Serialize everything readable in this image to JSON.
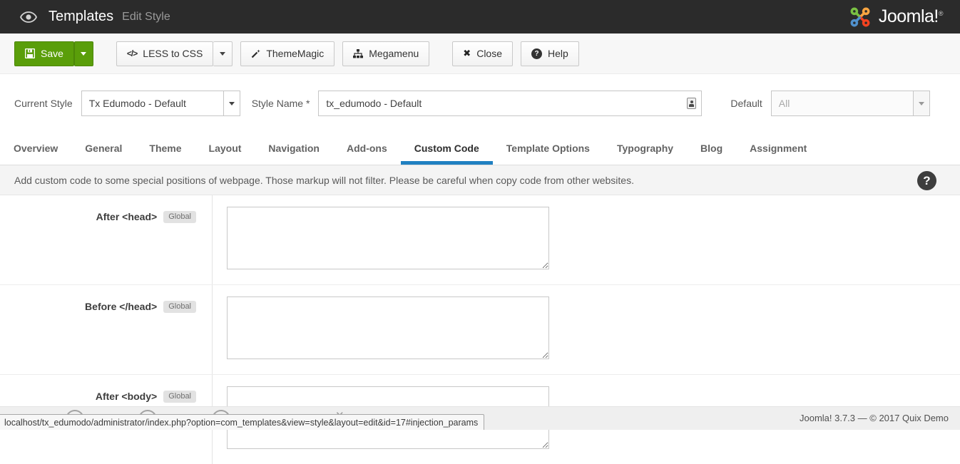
{
  "header": {
    "title": "Templates",
    "subtitle": "Edit Style",
    "logo_text": "Joomla!",
    "logo_reg": "®"
  },
  "toolbar": {
    "save_label": "Save",
    "less_to_css_label": "LESS to CSS",
    "thememagic_label": "ThemeMagic",
    "megamenu_label": "Megamenu",
    "close_label": "Close",
    "help_label": "Help"
  },
  "icons": {
    "code_glyph": "</>",
    "close_glyph": "✖",
    "help_glyph": "?",
    "wand_glyph": "✐",
    "notice_help_glyph": "?"
  },
  "style_bar": {
    "current_style_label": "Current Style",
    "current_style_value": "Tx Edumodo - Default",
    "style_name_label": "Style Name *",
    "style_name_value": "tx_edumodo - Default",
    "default_label": "Default",
    "default_value": "All"
  },
  "tabs": [
    {
      "label": "Overview",
      "active": false
    },
    {
      "label": "General",
      "active": false
    },
    {
      "label": "Theme",
      "active": false
    },
    {
      "label": "Layout",
      "active": false
    },
    {
      "label": "Navigation",
      "active": false
    },
    {
      "label": "Add-ons",
      "active": false
    },
    {
      "label": "Custom Code",
      "active": true
    },
    {
      "label": "Template Options",
      "active": false
    },
    {
      "label": "Typography",
      "active": false
    },
    {
      "label": "Blog",
      "active": false
    },
    {
      "label": "Assignment",
      "active": false
    }
  ],
  "notice_text": "Add custom code to some special positions of webpage. Those markup will not filter. Please be careful when copy code from other websites.",
  "fields": [
    {
      "label": "After <head>",
      "badge": "Global",
      "value": ""
    },
    {
      "label": "Before </head>",
      "badge": "Global",
      "value": ""
    },
    {
      "label": "After <body>",
      "badge": "Global",
      "value": ""
    }
  ],
  "statusbar": {
    "url": "localhost/tx_edumodo/administrator/index.php?option=com_templates&view=style&layout=edit&id=17#injection_params"
  },
  "footer": {
    "version_text": "Joomla! 3.7.3  —  © 2017 Quix Demo"
  },
  "colors": {
    "header_bg": "#2b2b2b",
    "save_green": "#5a9e0a",
    "tab_underline": "#1f80c1",
    "logo_orange": "#f9a541",
    "logo_green": "#7ac143",
    "logo_blue": "#5091cd",
    "logo_red": "#f44321"
  }
}
